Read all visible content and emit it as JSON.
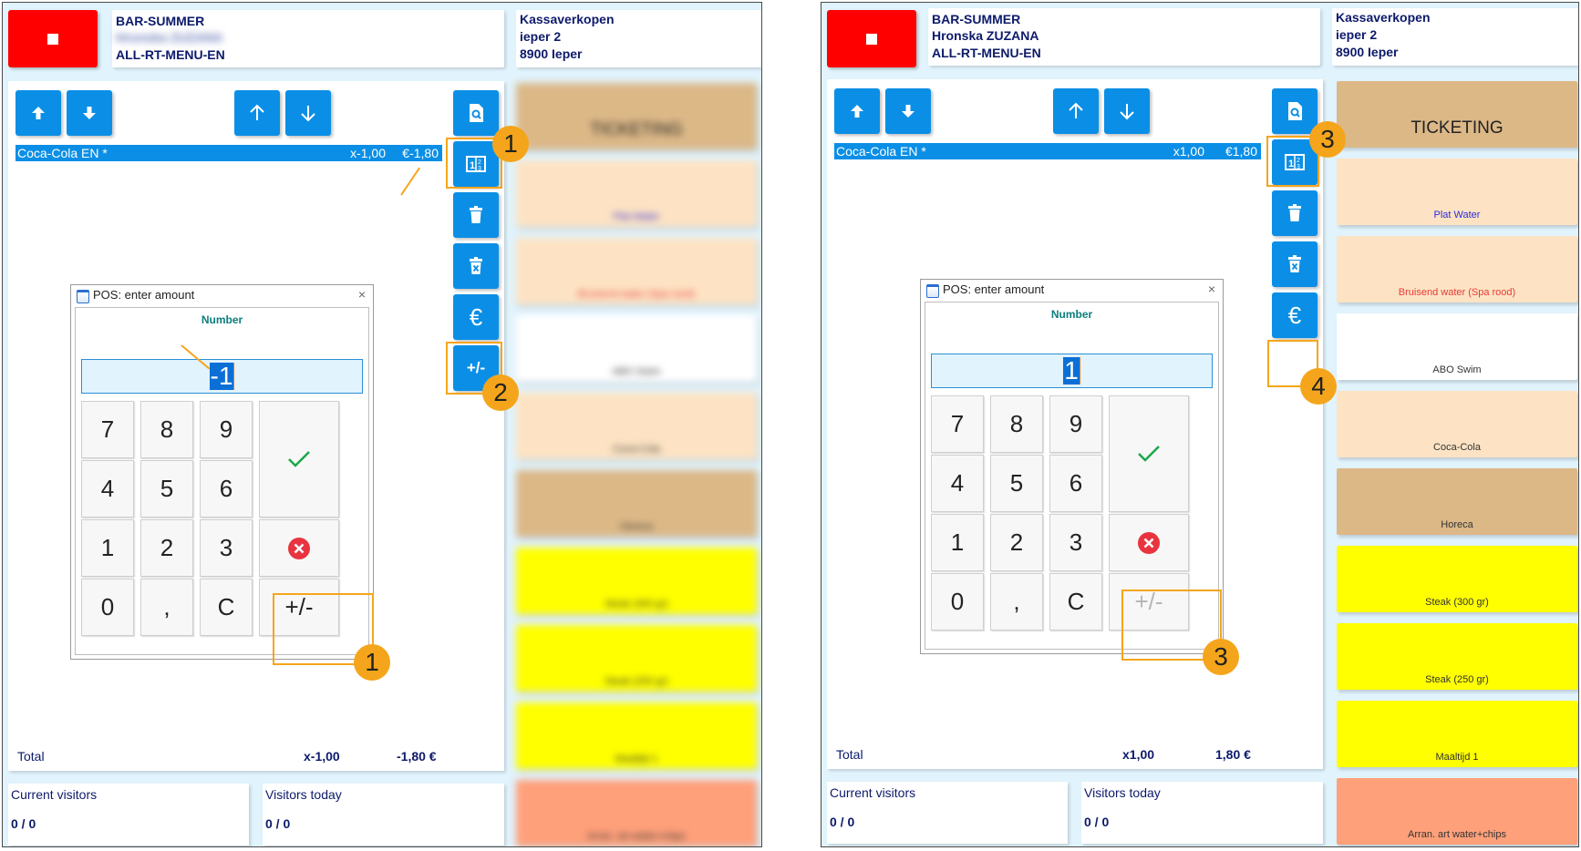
{
  "screens": [
    {
      "id": "before",
      "header": {
        "location": "BAR-SUMMER",
        "user": "Hronska ZUZANA",
        "user_blurred": true,
        "menu": "ALL-RT-MENU-EN",
        "address_line1": "Kassaverkopen",
        "address_line2": "ieper 2",
        "address_line3": "8900 Ieper"
      },
      "order_line": {
        "name": "Coca-Cola EN *",
        "qty": "x-1,00",
        "price": "€-1,80"
      },
      "total": {
        "label": "Total",
        "qty": "x-1,00",
        "amount": "-1,80 €"
      },
      "visitors": {
        "current_label": "Current visitors",
        "current_value": "0 / 0",
        "today_label": "Visitors today",
        "today_value": "0 / 0"
      },
      "side_buttons": {
        "plus_minus_label": "+/-",
        "plus_minus_visible": true
      },
      "products_blurred": true,
      "dialog": {
        "title": "POS: enter amount",
        "close": "×",
        "field_label": "Number",
        "value": "-1",
        "keys": [
          "7",
          "8",
          "9",
          "4",
          "5",
          "6",
          "1",
          "2",
          "3",
          "0",
          ",",
          "C"
        ],
        "plus_minus": "+/-",
        "plus_minus_enabled": true
      },
      "annotations": {
        "badge_a": "1",
        "badge_b": "2",
        "badge_c": "1"
      }
    },
    {
      "id": "after",
      "header": {
        "location": "BAR-SUMMER",
        "user": "Hronska ZUZANA",
        "user_blurred": false,
        "menu": "ALL-RT-MENU-EN",
        "address_line1": "Kassaverkopen",
        "address_line2": "ieper 2",
        "address_line3": "8900 Ieper"
      },
      "order_line": {
        "name": "Coca-Cola EN *",
        "qty": "x1,00",
        "price": "€1,80"
      },
      "total": {
        "label": "Total",
        "qty": "x1,00",
        "amount": "1,80 €"
      },
      "visitors": {
        "current_label": "Current visitors",
        "current_value": "0 / 0",
        "today_label": "Visitors today",
        "today_value": "0 / 0"
      },
      "side_buttons": {
        "plus_minus_label": "",
        "plus_minus_visible": false
      },
      "products_blurred": false,
      "dialog": {
        "title": "POS: enter amount",
        "close": "×",
        "field_label": "Number",
        "value": "1",
        "keys": [
          "7",
          "8",
          "9",
          "4",
          "5",
          "6",
          "1",
          "2",
          "3",
          "0",
          ",",
          "C"
        ],
        "plus_minus": "+/-",
        "plus_minus_enabled": false
      },
      "annotations": {
        "badge_a": "3",
        "badge_b": "4",
        "badge_c": "3"
      }
    }
  ],
  "products": [
    {
      "label": "TICKETING",
      "bg": "#dcb887",
      "color": "#222222",
      "big": true
    },
    {
      "label": "Plat Water",
      "bg": "#fde3c3",
      "color": "#2b2be0"
    },
    {
      "label": "Bruisend water (Spa rood)",
      "bg": "#fde3c3",
      "color": "#e83a3a"
    },
    {
      "label": "ABO Swim",
      "bg": "#ffffff",
      "color": "#333333"
    },
    {
      "label": "Coca-Cola",
      "bg": "#fde3c3",
      "color": "#333333"
    },
    {
      "label": "Horeca",
      "bg": "#dcb887",
      "color": "#333333"
    },
    {
      "label": "Steak (300 gr)",
      "bg": "#ffff00",
      "color": "#333333"
    },
    {
      "label": "Steak (250 gr)",
      "bg": "#ffff00",
      "color": "#333333"
    },
    {
      "label": "Maaltijd 1",
      "bg": "#ffff00",
      "color": "#333333"
    },
    {
      "label": "Arran. art water+chips",
      "bg": "#fea07a",
      "color": "#333333"
    }
  ],
  "icons": {
    "stop": "stop-square-icon",
    "up_filled": "arrow-up-icon",
    "down_filled": "arrow-down-icon",
    "up_thin": "arrow-up-thin-icon",
    "down_thin": "arrow-down-thin-icon",
    "search_doc": "document-search-icon",
    "calculator": "number-pad-icon",
    "trash": "trash-icon",
    "trash_x": "trash-clear-icon",
    "euro": "euro-icon",
    "confirm": "checkmark-icon",
    "cancel": "cancel-circle-icon"
  },
  "colors": {
    "accent_blue": "#0b8fe6",
    "stop_red": "#ff0000",
    "annotation_orange": "#f5a51b",
    "text_navy": "#0d1a6b",
    "panel_bg": "#e1f3fc"
  }
}
